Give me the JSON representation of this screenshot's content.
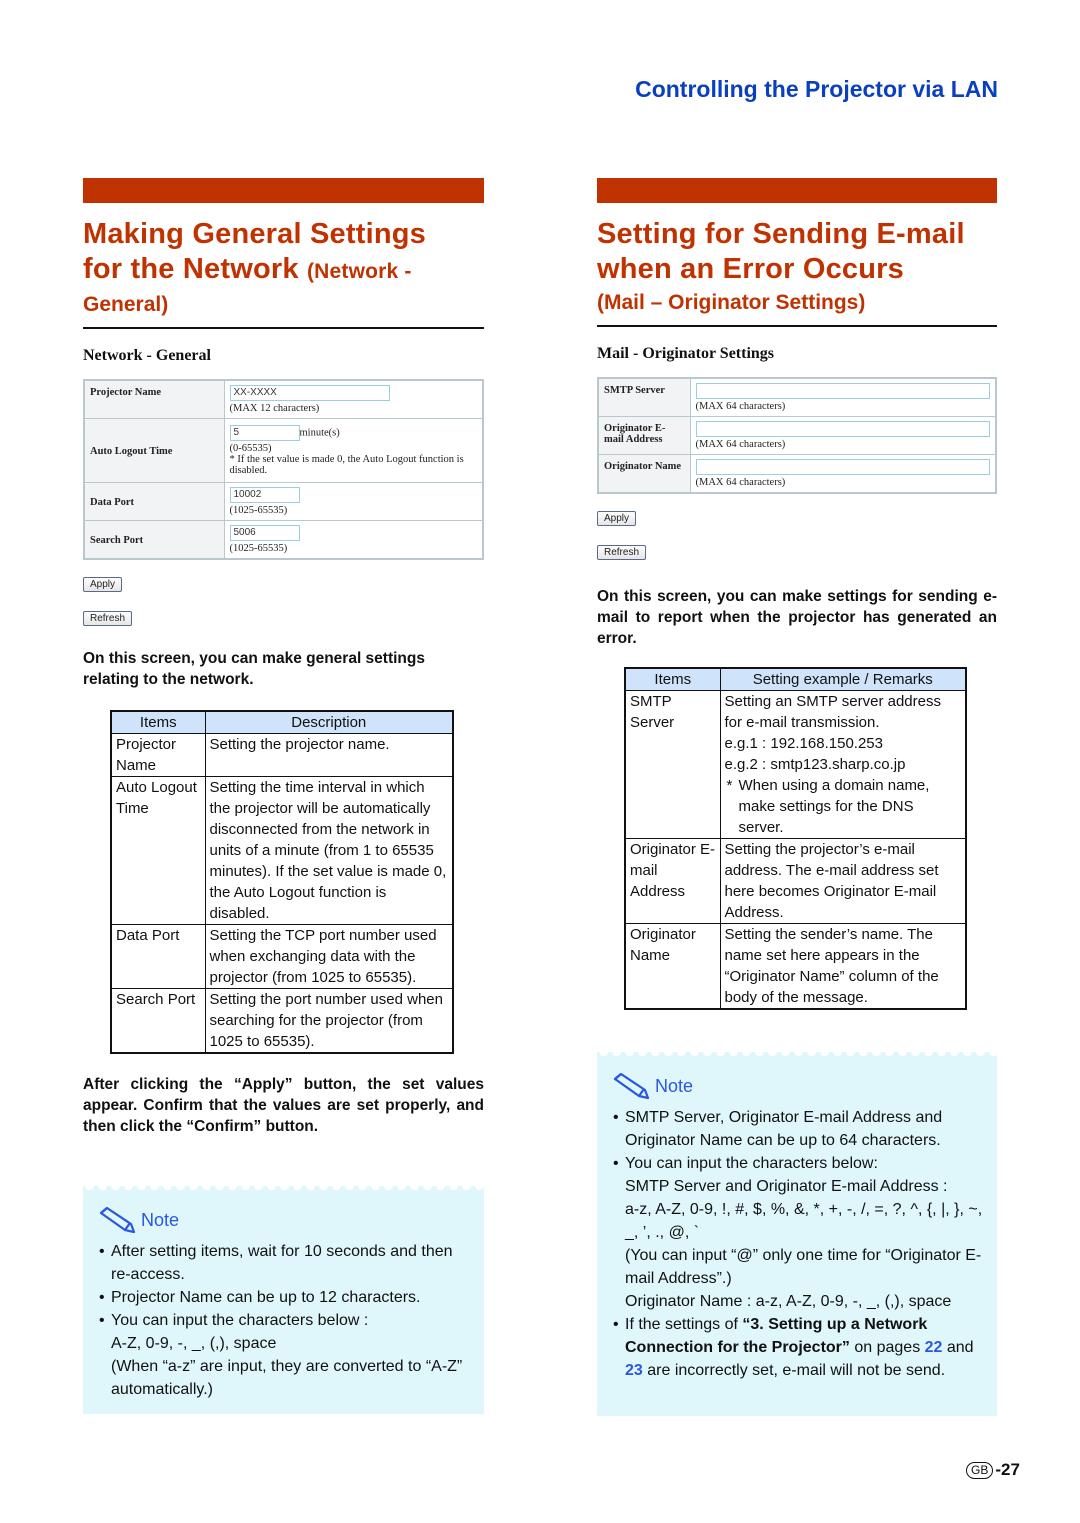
{
  "header": {
    "title": "Controlling the Projector via LAN"
  },
  "left": {
    "title_line1": "Making General Settings",
    "title_line2": "for the Network",
    "title_paren": "(Network -",
    "title_line3": "General)",
    "capture": {
      "title": "Network - General",
      "rows": [
        {
          "label": "Projector Name",
          "value": "XX-XXXX",
          "hint": "(MAX 12 characters)"
        },
        {
          "label": "Auto Logout Time",
          "value": "5",
          "unit": "minute(s)",
          "hint": "(0-65535)",
          "note": "* If the set value is made 0, the Auto Logout function is disabled."
        },
        {
          "label": "Data Port",
          "value": "10002",
          "hint": "(1025-65535)"
        },
        {
          "label": "Search Port",
          "value": "5006",
          "hint": "(1025-65535)"
        }
      ],
      "apply_label": "Apply",
      "refresh_label": "Refresh"
    },
    "intro": "On this screen, you can make general settings relating to the network.",
    "table": {
      "headers": [
        "Items",
        "Description"
      ],
      "rows": [
        {
          "item": "Projector Name",
          "desc": "Setting the projector name."
        },
        {
          "item": "Auto Logout Time",
          "desc": "Setting the time interval in which the projector will be automatically disconnected from the network in units of a minute (from 1 to 65535 minutes). If the set value is made 0, the Auto Logout function is disabled."
        },
        {
          "item": "Data Port",
          "desc": "Setting the TCP port number used when exchanging data with the projector (from 1025 to 65535)."
        },
        {
          "item": "Search Port",
          "desc": "Setting the port number used when searching for the projector (from 1025 to 65535)."
        }
      ]
    },
    "after_apply": "After clicking the “Apply” button, the set values appear. Confirm that the values are set properly, and then click the “Confirm” button.",
    "note": {
      "label": "Note",
      "items": [
        "After setting items, wait for 10 seconds and then re-access.",
        "Projector Name can be up to 12 characters.",
        "You can input the characters below :"
      ],
      "chars": "A-Z, 0-9, -, _, (,), space",
      "conversion": "(When “a-z” are input, they are converted to “A-Z” automatically.)"
    }
  },
  "right": {
    "title_line1": "Setting for Sending E-mail",
    "title_line2": "when an Error Occurs",
    "subtitle": "(Mail – Originator Settings)",
    "capture": {
      "title": "Mail - Originator Settings",
      "rows": [
        {
          "label": "SMTP Server",
          "value": "",
          "hint": "(MAX 64 characters)"
        },
        {
          "label": "Originator E-mail Address",
          "value": "",
          "hint": "(MAX 64 characters)"
        },
        {
          "label": "Originator Name",
          "value": "",
          "hint": "(MAX 64 characters)"
        }
      ],
      "apply_label": "Apply",
      "refresh_label": "Refresh"
    },
    "intro": "On this screen, you can make settings for sending e-mail to report when the projector has generated an error.",
    "table": {
      "headers": [
        "Items",
        "Setting example / Remarks"
      ],
      "rows": [
        {
          "item": "SMTP Server",
          "desc": "Setting an SMTP server address for e-mail transmission.",
          "eg1": "e.g.1 : 192.168.150.253",
          "eg2": "e.g.2 : smtp123.sharp.co.jp",
          "star": "When using a domain name, make settings for the DNS server."
        },
        {
          "item": "Originator E-mail Address",
          "desc": "Setting the projector’s e-mail address. The e-mail address set here becomes Originator E-mail Address."
        },
        {
          "item": "Originator Name",
          "desc": "Setting the sender’s name. The name set here appears in the “Originator Name” column of the body of the message."
        }
      ]
    },
    "note": {
      "label": "Note",
      "item1": "SMTP Server, Originator E-mail Address and Originator Name can be up to 64 characters.",
      "item2": "You can input the characters below:",
      "smtp_label": "SMTP Server and Originator E-mail Address :",
      "smtp_chars": "a-z, A-Z, 0-9, !, #, $, %, &, *, +, -, /, =, ?, ^, {, |, }, ~, _, ’, ., @, `",
      "at_note": "(You can input “@” only one time for “Originator E-mail Address”.)",
      "name_chars": "Originator Name : a-z, A-Z, 0-9, -, _, (,), space",
      "item3_pre": "If the settings of ",
      "item3_bold": "“3. Setting up a Network Connection for the Projector”",
      "item3_mid": " on pages ",
      "page_a": "22",
      "item3_and": " and ",
      "page_b": "23",
      "item3_post": " are incorrectly set, e-mail will not be send."
    }
  },
  "footer": {
    "region": "GB",
    "page": "-27"
  }
}
